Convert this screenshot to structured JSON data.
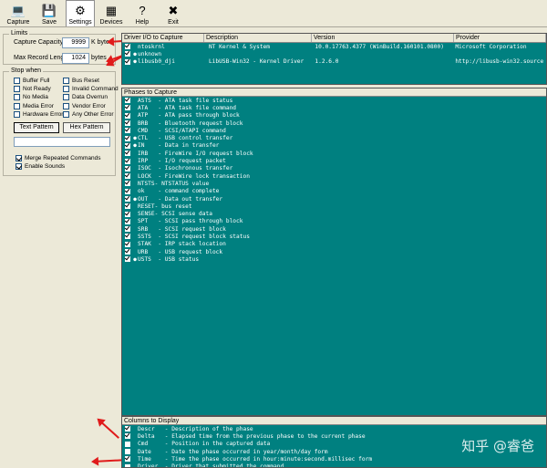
{
  "toolbar": {
    "buttons": [
      {
        "label": "Capture",
        "icon": "capture-icon"
      },
      {
        "label": "Save",
        "icon": "save-icon"
      },
      {
        "label": "Settings",
        "icon": "settings-icon"
      },
      {
        "label": "Devices",
        "icon": "devices-icon"
      },
      {
        "label": "Help",
        "icon": "help-icon"
      },
      {
        "label": "Exit",
        "icon": "exit-icon"
      }
    ]
  },
  "limits": {
    "title": "Limits",
    "capacity_label": "Capture Capacity",
    "capacity_value": "9999",
    "capacity_unit": "K bytes",
    "max_record_label": "Max Record Length",
    "max_record_value": "1024",
    "max_record_unit": "bytes"
  },
  "stop_when": {
    "title": "Stop when",
    "left": [
      "Buffer Full",
      "Not Ready",
      "No Media",
      "Media Error",
      "Hardware Error"
    ],
    "right": [
      "Bus Reset",
      "Invalid Command",
      "Data Overrun",
      "Vendor Error",
      "Any Other Error"
    ],
    "text_pattern_label": "Text Pattern",
    "hex_pattern_label": "Hex Pattern",
    "pattern_value": ""
  },
  "options": {
    "merge_label": "Merge Repeated Commands",
    "sounds_label": "Enable Sounds"
  },
  "drivers": {
    "columns": [
      "Driver I/O to Capture",
      "Description",
      "Version",
      "Provider"
    ],
    "rows": [
      {
        "name": "ntoskrnl",
        "desc": "NT Kernel & System",
        "version": "10.0.17763.4377 (WinBuild.160101.0800)",
        "provider": "Microsoft Corporation",
        "checked": true,
        "marked": false
      },
      {
        "name": "unknown",
        "desc": "",
        "version": "",
        "provider": "",
        "checked": true,
        "marked": true
      },
      {
        "name": "libusb0_dji",
        "desc": "LibUSB-Win32 - Kernel Driver",
        "version": "1.2.6.0",
        "provider": "http://libusb-win32.source",
        "checked": true,
        "marked": true
      }
    ]
  },
  "phases": {
    "title": "Phases to Capture",
    "rows": [
      {
        "text": "ASTS  - ATA task file status",
        "checked": true,
        "marked": false
      },
      {
        "text": "ATA   - ATA task file command",
        "checked": true,
        "marked": false
      },
      {
        "text": "ATP   - ATA pass through block",
        "checked": true,
        "marked": false
      },
      {
        "text": "BRB   - Bluetooth request block",
        "checked": true,
        "marked": false
      },
      {
        "text": "CMD   - SCSI/ATAPI command",
        "checked": true,
        "marked": false
      },
      {
        "text": "CTL   - USB control transfer",
        "checked": true,
        "marked": true
      },
      {
        "text": "IN    - Data in transfer",
        "checked": true,
        "marked": true
      },
      {
        "text": "IRB   - FireWire I/O request block",
        "checked": true,
        "marked": false
      },
      {
        "text": "IRP   - I/O request packet",
        "checked": true,
        "marked": false
      },
      {
        "text": "ISOC  - Isochronous transfer",
        "checked": true,
        "marked": false
      },
      {
        "text": "LOCK  - FireWire lock transaction",
        "checked": true,
        "marked": false
      },
      {
        "text": "NTSTS- NTSTATUS value",
        "checked": true,
        "marked": false
      },
      {
        "text": "ok    - command complete",
        "checked": true,
        "marked": false
      },
      {
        "text": "OUT   - Data out transfer",
        "checked": true,
        "marked": true
      },
      {
        "text": "RESET- bus reset",
        "checked": true,
        "marked": false
      },
      {
        "text": "SENSE- SCSI sense data",
        "checked": true,
        "marked": false
      },
      {
        "text": "SPT   - SCSI pass through block",
        "checked": true,
        "marked": false
      },
      {
        "text": "SRB   - SCSI request block",
        "checked": true,
        "marked": false
      },
      {
        "text": "SSTS  - SCSI request block status",
        "checked": true,
        "marked": false
      },
      {
        "text": "STAK  - IRP stack location",
        "checked": true,
        "marked": false
      },
      {
        "text": "URB   - USB request block",
        "checked": true,
        "marked": false
      },
      {
        "text": "USTS  - USB status",
        "checked": true,
        "marked": true
      }
    ]
  },
  "columns_display": {
    "title": "Columns to Display",
    "rows": [
      {
        "text": "Descr   - Description of the phase",
        "checked": true
      },
      {
        "text": "Delta   - Elapsed time from the previous phase to the current phase",
        "checked": true
      },
      {
        "text": "Cmd     - Position in the captured data",
        "checked": false
      },
      {
        "text": "Date    - Date the phase occurred in year/month/day form",
        "checked": false
      },
      {
        "text": "Time    - Time the phase occurred in hour:minute:second.millisec form",
        "checked": true
      },
      {
        "text": "Driver  - Driver that submitted the command",
        "checked": false
      }
    ]
  },
  "watermark": "知乎 @睿爸",
  "colors": {
    "accent_teal": "#008080",
    "arrow_red": "#e01b1b"
  }
}
